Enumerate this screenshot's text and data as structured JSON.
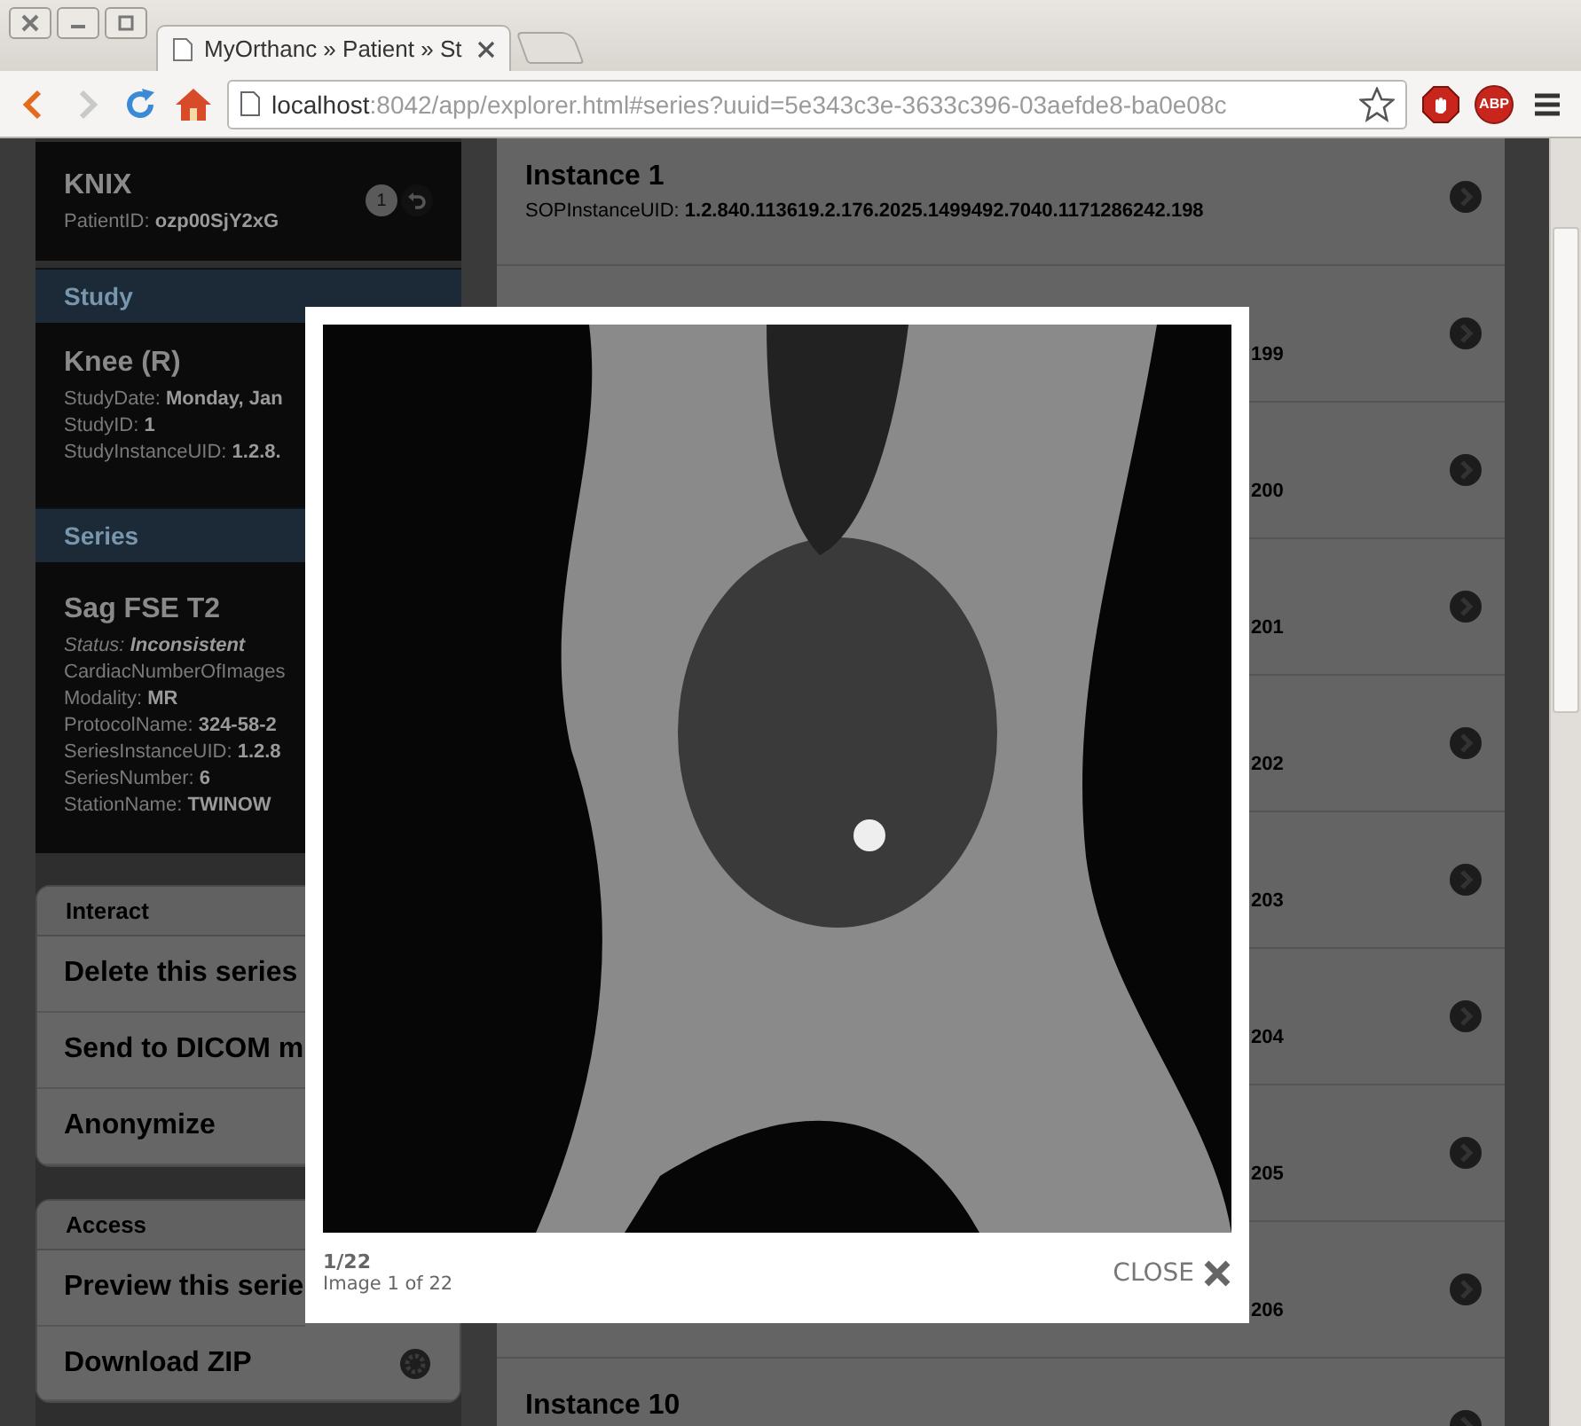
{
  "browser": {
    "tab_title": "MyOrthanc » Patient » St",
    "address_host": "localhost",
    "address_path": ":8042/app/explorer.html#series?uuid=5e343c3e-3633c396-03aefde8-ba0e08c",
    "extensions": [
      {
        "kind": "stop"
      },
      {
        "kind": "abp",
        "label": "ABP"
      }
    ]
  },
  "patient": {
    "name": "KNIX",
    "id_label": "PatientID:",
    "id": "ozp00SjY2xG",
    "badge": "1"
  },
  "study_header": "Study",
  "study": {
    "title": "Knee (R)",
    "fields": [
      {
        "label": "StudyDate:",
        "value": "Monday, Jan"
      },
      {
        "label": "StudyID:",
        "value": "1"
      },
      {
        "label": "StudyInstanceUID:",
        "value": "1.2.8."
      }
    ]
  },
  "series_header": "Series",
  "series": {
    "title": "Sag FSE T2",
    "status_label": "Status:",
    "status": "Inconsistent",
    "fields": [
      {
        "label": "CardiacNumberOfImages"
      },
      {
        "label": "Modality:",
        "value": "MR"
      },
      {
        "label": "ProtocolName:",
        "value": "324-58-2"
      },
      {
        "label": "SeriesInstanceUID:",
        "value": "1.2.8"
      },
      {
        "label": "SeriesNumber:",
        "value": "6"
      },
      {
        "label": "StationName:",
        "value": "TWINOW"
      }
    ]
  },
  "interact": {
    "header": "Interact",
    "items": [
      {
        "label": "Delete this series"
      },
      {
        "label": "Send to DICOM m"
      },
      {
        "label": "Anonymize"
      }
    ]
  },
  "access": {
    "header": "Access",
    "items": [
      {
        "label": "Preview this serie"
      },
      {
        "label": "Download ZIP",
        "has_icon": true
      }
    ]
  },
  "instances": [
    {
      "title": "Instance 1",
      "uid_label": "SOPInstanceUID:",
      "uid": "1.2.840.113619.2.176.2025.1499492.7040.1171286242.198"
    },
    {
      "uid": "199"
    },
    {
      "uid": "200"
    },
    {
      "uid": "201"
    },
    {
      "uid": "202"
    },
    {
      "uid": "203"
    },
    {
      "uid": "204"
    },
    {
      "uid": "205"
    },
    {
      "uid": "206"
    },
    {
      "title": "Instance 10"
    }
  ],
  "lightbox": {
    "counter": "1/22",
    "caption": "Image 1 of 22",
    "close_label": "CLOSE"
  }
}
